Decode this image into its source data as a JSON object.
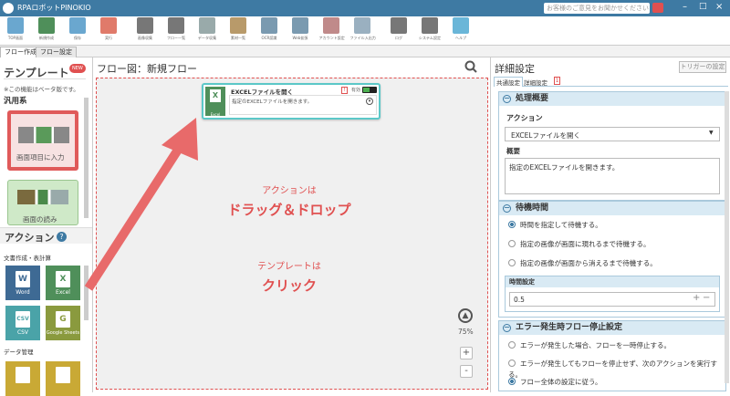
{
  "app": {
    "title": "RPAロボットPINOKIO",
    "feedback_placeholder": "お客様のご意見をお聞かせください"
  },
  "ribbon": {
    "items": [
      {
        "label": "TOP画面",
        "icon": "pinokio-logo-icon"
      },
      {
        "label": "新規作成",
        "icon": "new-file-icon"
      },
      {
        "label": "保存",
        "icon": "save-icon"
      },
      {
        "label": "実行",
        "icon": "play-icon"
      },
      {
        "label": "画像収集",
        "icon": "image-capture-icon"
      },
      {
        "label": "フロー一覧",
        "icon": "list-icon"
      },
      {
        "label": "データ収集",
        "icon": "database-icon"
      },
      {
        "label": "素材一覧",
        "icon": "folder-icon"
      },
      {
        "label": "OCR認識",
        "icon": "ocr-icon"
      },
      {
        "label": "Web拡張",
        "icon": "web-icon"
      },
      {
        "label": "アカウント設定",
        "icon": "account-icon"
      },
      {
        "label": "ファイル入出力",
        "icon": "file-io-icon"
      },
      {
        "label": "ログ",
        "icon": "log-icon"
      },
      {
        "label": "システム設定",
        "icon": "gear-icon"
      },
      {
        "label": "ヘルプ",
        "icon": "help-icon"
      }
    ]
  },
  "tabs": [
    "フロー作成",
    "フロー設定"
  ],
  "left": {
    "template_title": "テンプレート",
    "new_badge": "NEW",
    "beta_note": "※この機能はベータ版です。",
    "category_general": "汎用系",
    "template1_label": "画面項目に入力",
    "template2_label": "画面の読み",
    "action_title": "アクション",
    "help_mark": "?",
    "group_docs": "文書作成・表計算",
    "actions": [
      {
        "label": "Word",
        "glyph": "W",
        "color": "#3e6a94"
      },
      {
        "label": "Excel",
        "glyph": "X",
        "color": "#4f8f5a"
      },
      {
        "label": "CSV",
        "glyph": "CSV",
        "color": "#4aa3a8"
      },
      {
        "label": "Google Sheets",
        "glyph": "G",
        "color": "#8a9a3e"
      }
    ],
    "group_data": "データ管理"
  },
  "flow": {
    "header": "フロー図：新規フロー",
    "node": {
      "title": "EXCELファイルを開く",
      "desc": "指定のEXCELファイルを開きます。",
      "badge_error": "!",
      "badge_text": "有効",
      "icon_label": "Excel"
    },
    "hint_action_line1": "アクションは",
    "hint_action_line2": "ドラッグ＆ドロップ",
    "hint_template_line1": "テンプレートは",
    "hint_template_line2": "クリック",
    "zoom": "75%",
    "zoom_in": "+",
    "zoom_out": "-"
  },
  "right": {
    "title": "詳細設定",
    "trigger_button": "トリガーの設定",
    "tab_common": "共通設定",
    "tab_detail": "詳細設定",
    "tab_detail_badge": "1",
    "section1_title": "処理概要",
    "action_label": "アクション",
    "action_value": "EXCELファイルを開く",
    "summary_label": "概要",
    "summary_value": "指定のEXCELファイルを開きます。",
    "section2_title": "待機時間",
    "wait_options": [
      "時間を指定して待機する。",
      "指定の画像が画面に現れるまで待機する。",
      "指定の画像が画面から消えるまで待機する。"
    ],
    "time_label": "時間設定",
    "time_value": "0.5",
    "section3_title": "エラー発生時フロー停止設定",
    "error_options": [
      "エラーが発生した場合、フローを一時停止する。",
      "エラーが発生してもフローを停止せず、次のアクションを実行する。",
      "フロー全体の設定に従う。"
    ]
  }
}
